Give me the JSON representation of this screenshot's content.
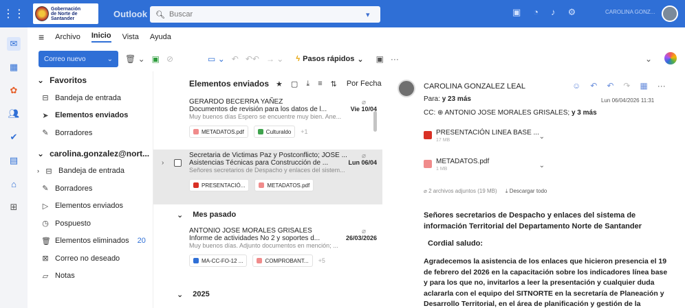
{
  "header": {
    "gov_logo_lines": [
      "Gobernación",
      "de Norte de",
      "Santander"
    ],
    "app_name": "Outlook",
    "search_placeholder": "Buscar",
    "user_name": "CAROLINA GONZ..."
  },
  "ribbon": {
    "tabs": [
      "Archivo",
      "Inicio",
      "Vista",
      "Ayuda"
    ],
    "active_tab": "Inicio",
    "new_mail": "Correo nuevo",
    "quick_steps": "Pasos rápidos",
    "more": "···"
  },
  "folders": {
    "favorites_label": "Favoritos",
    "favorites": [
      {
        "label": "Bandeja de entrada",
        "icon": "inbox-icon"
      },
      {
        "label": "Elementos enviados",
        "icon": "sent-icon",
        "selected": true
      },
      {
        "label": "Borradores",
        "icon": "drafts-icon"
      }
    ],
    "account_label": "carolina.gonzalez@nort...",
    "account": [
      {
        "label": "Bandeja de entrada",
        "icon": "inbox-icon"
      },
      {
        "label": "Borradores",
        "icon": "drafts-icon"
      },
      {
        "label": "Elementos enviados",
        "icon": "sent-icon"
      },
      {
        "label": "Pospuesto",
        "icon": "clock-icon"
      },
      {
        "label": "Elementos eliminados",
        "icon": "trash-icon",
        "count": "20"
      },
      {
        "label": "Correo no deseado",
        "icon": "junk-icon"
      },
      {
        "label": "Notas",
        "icon": "notes-icon"
      }
    ]
  },
  "list": {
    "title": "Elementos enviados",
    "sort_label": "Por Fecha",
    "messages": [
      {
        "from": "GERARDO BECERRA YAÑEZ",
        "subject": "Documentos de revisión para los datos de l...",
        "date": "Vie 10/04",
        "preview": "Muy buenos días Espero se encuentre muy bien. Ane...",
        "attachments": [
          "METADATOS.pdf",
          "Culturaldo"
        ],
        "more": "+1"
      },
      {
        "from": "Secretaria de Victimas Paz y Postconflicto; JOSE ...",
        "subject": "Asistencias Técnicas para Construcción de ...",
        "date": "Lun 06/04",
        "preview": "Señores secretarios de Despacho y enlaces del sistem...",
        "attachments": [
          "PRESENTACIÓ...",
          "METADATOS.pdf"
        ]
      }
    ],
    "group_last_month": "Mes pasado",
    "message_3": {
      "from": "ANTONIO JOSE MORALES GRISALES",
      "subject": "Informe de actividades No 2 y soportes d...",
      "date": "26/03/2026",
      "preview": "Muy buenos días. Adjunto documentos en mención; ...",
      "attachments": [
        "MA-CC-FO-12 ...",
        "COMPROBANT..."
      ],
      "more": "+5"
    },
    "group_year": "2025"
  },
  "reader": {
    "from": "CAROLINA GONZALEZ LEAL",
    "to_label": "Para:",
    "to_value": "y 23 más",
    "date": "Lun 06/04/2026 11:31",
    "cc_label": "CC:",
    "cc_name": "ANTONIO JOSE MORALES GRISALES;",
    "cc_more": "y 3 más",
    "attachments": [
      {
        "name": "PRESENTACIÓN LINEA BASE ...",
        "size": "17 MB"
      },
      {
        "name": "METADATOS.pdf",
        "size": "1 MB"
      }
    ],
    "attachments_summary": "2 archivos adjuntos (19 MB)",
    "download_all": "Descargar todo",
    "heading": "Señores secretarios de Despacho y enlaces del sistema de información Territorial del Departamento Norte de Santander",
    "greeting": "Cordial saludo:",
    "body": "Agradecemos la asistencia de los enlaces que hicieron presencia el 19 de febrero del 2026 en la capacitación sobre los indicadores línea base y para los que no, invitarlos a leer la presentación y cualquier duda aclararla con el equipo del SITNORTE en la secretaría de Planeación y Desarrollo Territorial, en el área de planificación y gestión de la"
  },
  "colors": {
    "brand": "#2f6fd6",
    "pdf": "#d93025",
    "selected_bg": "#e8e8e8"
  }
}
